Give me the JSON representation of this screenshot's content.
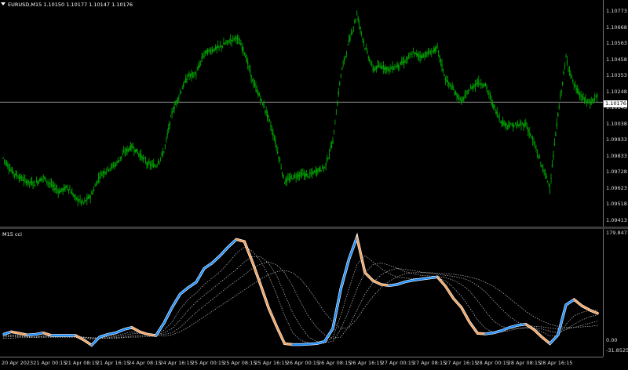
{
  "symbol_label": "EURUSD,M15  1.10150 1.10177 1.10147 1.10176",
  "indicator_label": "M15 cci",
  "current_price": "1.10176",
  "price_axis_ticks": [
    "1.10773",
    "1.10668",
    "1.10563",
    "1.10458",
    "1.10353",
    "1.10248",
    "1.10143",
    "1.10038",
    "1.09933",
    "1.09833",
    "1.09728",
    "1.09623",
    "1.09518",
    "1.09413"
  ],
  "indicator_axis_ticks": [
    "179.8471",
    "0.00",
    "-31.8525"
  ],
  "time_axis_ticks": [
    "20 Apr 2023",
    "21 Apr 00:15",
    "21 Apr 08:15",
    "21 Apr 16:15",
    "24 Apr 08:15",
    "24 Apr 16:15",
    "25 Apr 00:15",
    "25 Apr 08:15",
    "25 Apr 16:15",
    "26 Apr 00:15",
    "26 Apr 08:15",
    "26 Apr 16:15",
    "27 Apr 00:15",
    "27 Apr 08:15",
    "27 Apr 16:15",
    "28 Apr 00:15",
    "28 Apr 08:15",
    "28 Apr 16:15"
  ],
  "colors": {
    "background": "#000000",
    "candles": "#00a000",
    "cci_rising": "#1e90ff",
    "cci_falling": "#f4a460",
    "cci_outline": "#ffffff",
    "bands": "#bfbfbf",
    "price_line": "#c0c0c0"
  },
  "chart_data": [
    {
      "type": "line",
      "series": [
        {
          "values": [
            1.0983,
            1.0975,
            1.0971,
            1.0968,
            1.0967,
            1.0971,
            1.0966,
            1.0962,
            1.0965,
            1.0958,
            1.0955,
            1.096,
            1.0972,
            1.0976,
            1.0979,
            1.0986,
            1.099,
            1.0985,
            1.0979,
            1.0978,
            1.0987,
            1.1011,
            1.1023,
            1.1034,
            1.1035,
            1.1048,
            1.105,
            1.1052,
            1.1055,
            1.1058,
            1.1049,
            1.1031,
            1.102,
            1.1008,
            1.099,
            1.0968,
            1.0971,
            1.0973,
            1.0972,
            1.0975,
            1.0977,
            1.0993,
            1.1035,
            1.1055,
            1.1072,
            1.1052,
            1.1038,
            1.104,
            1.1038,
            1.104,
            1.1043,
            1.1048,
            1.1046,
            1.1048,
            1.1051,
            1.1032,
            1.1025,
            1.1018,
            1.1025,
            1.103,
            1.1028,
            1.1015,
            1.1005,
            1.1003,
            1.1003,
            1.1004,
            1.0992,
            1.0978,
            1.0965,
            1.101,
            1.1045,
            1.1028,
            1.102,
            1.1017,
            1.1022
          ]
        }
      ],
      "ylim": [
        1.09413,
        1.108
      ]
    },
    {
      "type": "line",
      "series": [
        {
          "values": [
            -5,
            0,
            -3,
            -6,
            -5,
            -2,
            -7,
            -7,
            -7,
            -7,
            -15,
            -25,
            -10,
            -5,
            -2,
            4,
            8,
            0,
            -5,
            -7,
            16,
            45,
            70,
            82,
            92,
            118,
            128,
            142,
            158,
            172,
            168,
            130,
            88,
            45,
            10,
            -22,
            -24,
            -24,
            -23,
            -22,
            -18,
            6,
            80,
            135,
            176,
            110,
            95,
            88,
            86,
            88,
            93,
            96,
            98,
            100,
            102,
            85,
            62,
            45,
            18,
            -3,
            -4,
            -2,
            2,
            8,
            12,
            14,
            4,
            -10,
            -22,
            -6,
            50,
            60,
            48,
            40,
            34
          ]
        },
        {
          "values": [
            -6,
            -6,
            -7,
            -10,
            -11,
            -8,
            -9,
            -8,
            -8,
            -9,
            -11,
            -14,
            -11,
            -9,
            -7,
            -4,
            0,
            -2,
            -4,
            -5,
            3,
            18,
            42,
            60,
            72,
            88,
            100,
            112,
            128,
            146,
            158,
            150,
            132,
            105,
            70,
            30,
            -2,
            -16,
            -21,
            -22,
            -21,
            -10,
            30,
            80,
            125,
            142,
            130,
            118,
            108,
            102,
            100,
            99,
            99,
            100,
            100,
            95,
            82,
            66,
            45,
            22,
            6,
            -1,
            0,
            2,
            6,
            8,
            6,
            0,
            -8,
            -8,
            14,
            30,
            36,
            40,
            40
          ]
        },
        {
          "values": [
            -8,
            -7,
            -8,
            -9,
            -9,
            -8,
            -8,
            -8,
            -8,
            -9,
            -10,
            -12,
            -12,
            -11,
            -9,
            -7,
            -4,
            -3,
            -4,
            -5,
            -2,
            6,
            22,
            40,
            55,
            68,
            80,
            92,
            104,
            116,
            130,
            140,
            140,
            128,
            105,
            70,
            35,
            10,
            -10,
            -18,
            -20,
            -18,
            5,
            40,
            80,
            110,
            125,
            128,
            124,
            118,
            112,
            108,
            105,
            104,
            103,
            101,
            96,
            88,
            76,
            58,
            38,
            20,
            10,
            6,
            6,
            7,
            7,
            5,
            1,
            -2,
            4,
            14,
            22,
            28,
            32
          ]
        },
        {
          "values": [
            -10,
            -9,
            -9,
            -9,
            -9,
            -9,
            -9,
            -9,
            -9,
            -9,
            -10,
            -11,
            -12,
            -12,
            -11,
            -10,
            -8,
            -7,
            -6,
            -6,
            -5,
            -2,
            8,
            22,
            36,
            48,
            60,
            72,
            84,
            95,
            106,
            118,
            126,
            130,
            125,
            110,
            85,
            55,
            28,
            8,
            -6,
            -12,
            -10,
            10,
            40,
            70,
            92,
            106,
            114,
            118,
            116,
            114,
            111,
            109,
            107,
            105,
            103,
            100,
            95,
            86,
            74,
            58,
            42,
            28,
            18,
            12,
            10,
            9,
            7,
            5,
            5,
            8,
            12,
            16,
            20
          ]
        },
        {
          "values": [
            -12,
            -12,
            -11,
            -11,
            -11,
            -11,
            -11,
            -11,
            -11,
            -11,
            -11,
            -11,
            -12,
            -12,
            -12,
            -11,
            -10,
            -10,
            -9,
            -8,
            -8,
            -6,
            0,
            8,
            18,
            28,
            38,
            48,
            58,
            68,
            78,
            88,
            98,
            106,
            112,
            114,
            110,
            98,
            80,
            58,
            36,
            18,
            6,
            8,
            24,
            46,
            66,
            82,
            94,
            102,
            108,
            110,
            110,
            110,
            109,
            108,
            107,
            105,
            102,
            98,
            92,
            84,
            74,
            62,
            50,
            38,
            28,
            20,
            14,
            10,
            8,
            8,
            9,
            10,
            12
          ]
        }
      ],
      "ylim": [
        -31.8525,
        179.8471
      ]
    }
  ]
}
